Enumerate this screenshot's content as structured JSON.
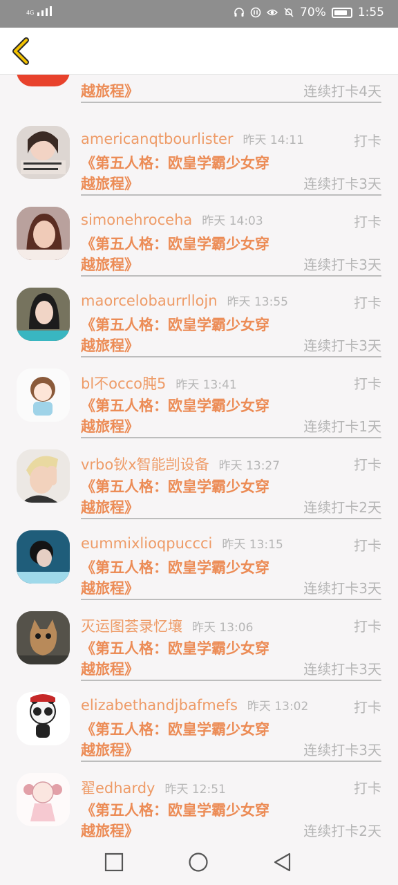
{
  "status_bar": {
    "network": "4G",
    "battery": "70%",
    "time": "1:55"
  },
  "colors": {
    "accent": "#ec8c56",
    "muted": "#b5b5b5",
    "back_arrow": "#f3c200"
  },
  "top_item": {
    "title_line2": "越旅程》",
    "streak": "连续打卡4天"
  },
  "items": [
    {
      "username": "americanqtbourlister",
      "time": "昨天 14:11",
      "checkin": "打卡",
      "title_line1": "《第五人格：欧皇学霸少女穿",
      "title_line2": "越旅程》",
      "streak": "连续打卡3天"
    },
    {
      "username": "simonehroceha",
      "time": "昨天 14:03",
      "checkin": "打卡",
      "title_line1": "《第五人格：欧皇学霸少女穿",
      "title_line2": "越旅程》",
      "streak": "连续打卡3天"
    },
    {
      "username": "maorcelobaurrllojn",
      "time": "昨天 13:55",
      "checkin": "打卡",
      "title_line1": "《第五人格：欧皇学霸少女穿",
      "title_line2": "越旅程》",
      "streak": "连续打卡3天"
    },
    {
      "username": "bl不occo肫5",
      "time": "昨天 13:41",
      "checkin": "打卡",
      "title_line1": "《第五人格：欧皇学霸少女穿",
      "title_line2": "越旅程》",
      "streak": "连续打卡1天"
    },
    {
      "username": "vrbo钬x智能剀设备",
      "time": "昨天 13:27",
      "checkin": "打卡",
      "title_line1": "《第五人格：欧皇学霸少女穿",
      "title_line2": "越旅程》",
      "streak": "连续打卡2天"
    },
    {
      "username": "eummixlioqpuccci",
      "time": "昨天 13:15",
      "checkin": "打卡",
      "title_line1": "《第五人格：欧皇学霸少女穿",
      "title_line2": "越旅程》",
      "streak": "连续打卡3天"
    },
    {
      "username": "灭运图荟录忆壤",
      "time": "昨天 13:06",
      "checkin": "打卡",
      "title_line1": "《第五人格：欧皇学霸少女穿",
      "title_line2": "越旅程》",
      "streak": "连续打卡3天"
    },
    {
      "username": "elizabethandjbafmefs",
      "time": "昨天 13:02",
      "checkin": "打卡",
      "title_line1": "《第五人格：欧皇学霸少女穿",
      "title_line2": "越旅程》",
      "streak": "连续打卡3天"
    },
    {
      "username": "翟edhardy",
      "time": "昨天 12:51",
      "checkin": "打卡",
      "title_line1": "《第五人格：欧皇学霸少女穿",
      "title_line2": "越旅程》",
      "streak": "连续打卡2天"
    }
  ]
}
